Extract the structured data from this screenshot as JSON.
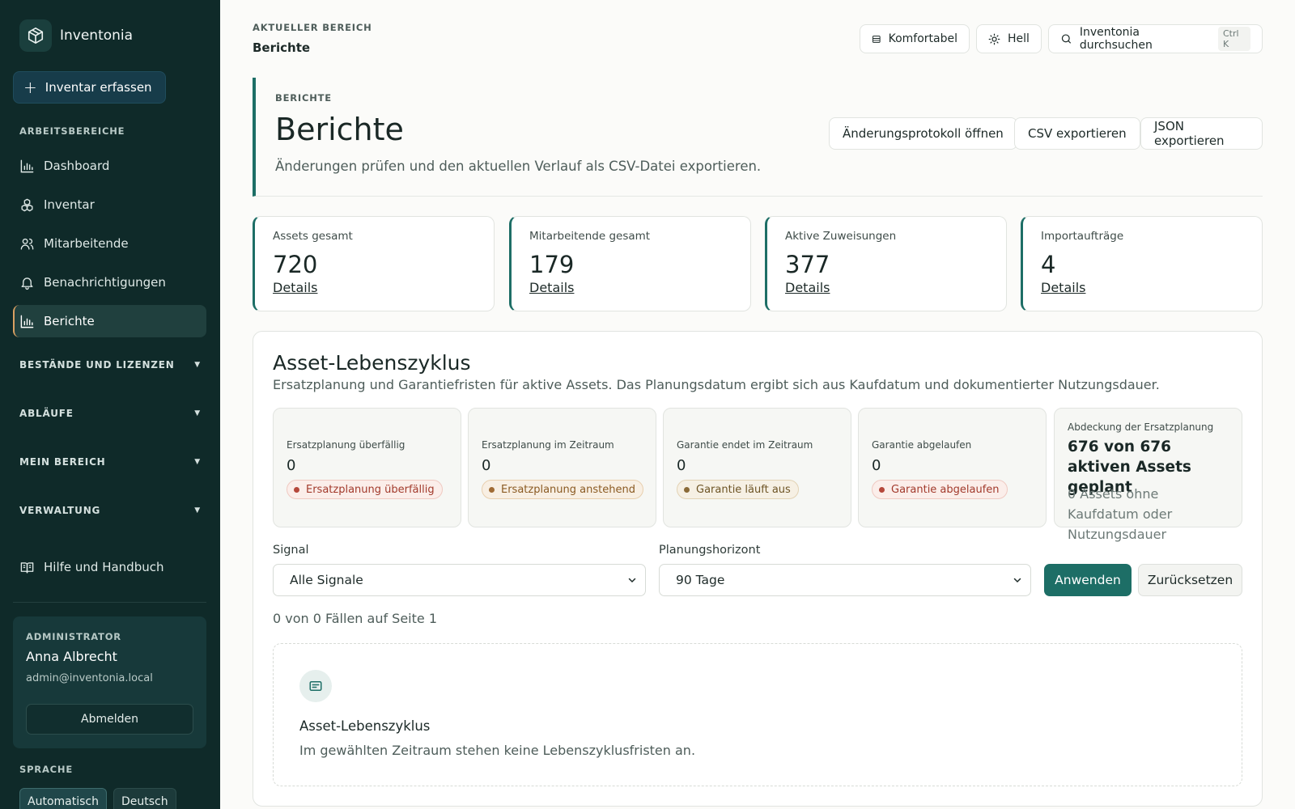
{
  "app": {
    "name": "Inventonia"
  },
  "sidebar": {
    "add_button": "Inventar erfassen",
    "section_label": "ARBEITSBEREICHE",
    "items": [
      {
        "label": "Dashboard",
        "icon": "bar-chart-icon"
      },
      {
        "label": "Inventar",
        "icon": "boxes-icon"
      },
      {
        "label": "Mitarbeitende",
        "icon": "users-icon"
      },
      {
        "label": "Benachrichtigungen",
        "icon": "bell-icon"
      },
      {
        "label": "Berichte",
        "icon": "bar-chart-icon",
        "active": true
      }
    ],
    "groups": [
      {
        "label": "BESTÄNDE UND LIZENZEN"
      },
      {
        "label": "ABLÄUFE"
      },
      {
        "label": "MEIN BEREICH"
      },
      {
        "label": "VERWALTUNG"
      }
    ],
    "help": "Hilfe und Handbuch",
    "user": {
      "role": "ADMINISTRATOR",
      "name": "Anna Albrecht",
      "email": "admin@inventonia.local",
      "logout": "Abmelden"
    },
    "language_label": "SPRACHE",
    "languages": [
      {
        "label": "Automatisch",
        "active": true
      },
      {
        "label": "Deutsch"
      }
    ]
  },
  "topbar": {
    "crumb_label": "AKTUELLER BEREICH",
    "crumb_title": "Berichte",
    "density": "Komfortabel",
    "theme": "Hell",
    "search": "Inventonia durchsuchen",
    "search_shortcut": "Ctrl K"
  },
  "header": {
    "label": "BERICHTE",
    "title": "Berichte",
    "description": "Änderungen prüfen und den aktuellen Verlauf als CSV-Datei exportieren.",
    "buttons": [
      "Änderungsprotokoll öffnen",
      "CSV exportieren",
      "JSON exportieren"
    ]
  },
  "stats": [
    {
      "label": "Assets gesamt",
      "value": "720",
      "link": "Details"
    },
    {
      "label": "Mitarbeitende gesamt",
      "value": "179",
      "link": "Details"
    },
    {
      "label": "Aktive Zuweisungen",
      "value": "377",
      "link": "Details"
    },
    {
      "label": "Importaufträge",
      "value": "4",
      "link": "Details"
    }
  ],
  "lifecycle": {
    "title": "Asset-Lebenszyklus",
    "description": "Ersatzplanung und Garantiefristen für aktive Assets. Das Planungsdatum ergibt sich aus Kaufdatum und dokumentierter Nutzungsdauer.",
    "kpis": [
      {
        "label": "Ersatzplanung überfällig",
        "value": "0",
        "badge": "Ersatzplanung überfällig",
        "tone": "red"
      },
      {
        "label": "Ersatzplanung im Zeitraum",
        "value": "0",
        "badge": "Ersatzplanung anstehend",
        "tone": "amber"
      },
      {
        "label": "Garantie endet im Zeitraum",
        "value": "0",
        "badge": "Garantie läuft aus",
        "tone": "olive"
      },
      {
        "label": "Garantie abgelaufen",
        "value": "0",
        "badge": "Garantie abgelaufen",
        "tone": "red"
      }
    ],
    "coverage": {
      "label": "Abdeckung der Ersatzplanung",
      "value": "676 von 676 aktiven Assets geplant",
      "note": "0 Assets ohne Kaufdatum oder Nutzungsdauer"
    },
    "filters": {
      "signal_label": "Signal",
      "signal_value": "Alle Signale",
      "horizon_label": "Planungshorizont",
      "horizon_value": "90 Tage",
      "apply": "Anwenden",
      "reset": "Zurücksetzen"
    },
    "count": "0 von 0 Fällen auf Seite 1",
    "empty": {
      "title": "Asset-Lebenszyklus",
      "description": "Im gewählten Zeitraum stehen keine Lebenszyklusfristen an."
    }
  }
}
